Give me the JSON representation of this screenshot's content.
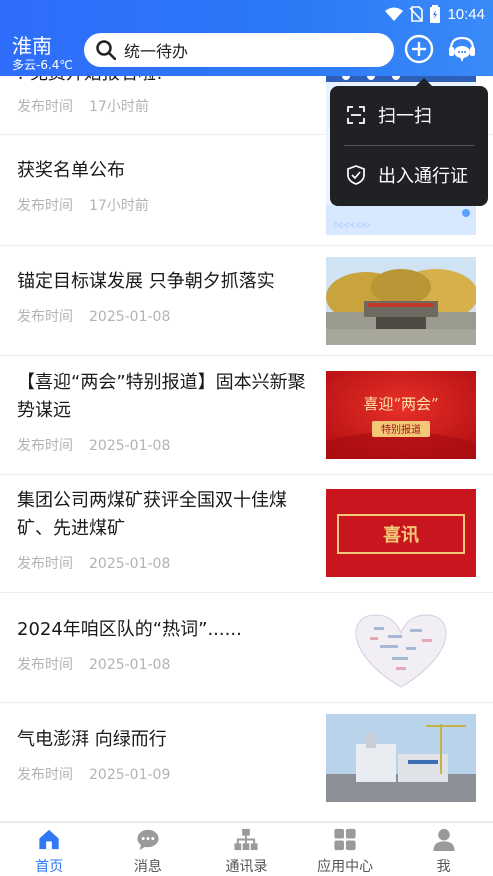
{
  "status": {
    "time": "10:44"
  },
  "header": {
    "city": "淮南",
    "weather": "多云-6.4℃",
    "search_placeholder": "统一待办"
  },
  "popup": {
    "scan_label": "扫一扫",
    "pass_label": "出入通行证"
  },
  "news": [
    {
      "title": "!·免费开始报名啦!",
      "meta_label": "发布时间",
      "time": "17小时前"
    },
    {
      "title": "获奖名单公布",
      "meta_label": "发布时间",
      "time": "17小时前"
    },
    {
      "title": "锚定目标谋发展 只争朝夕抓落实",
      "meta_label": "发布时间",
      "time": "2025-01-08"
    },
    {
      "title": "【喜迎“两会”特别报道】固本兴新聚势谋远",
      "meta_label": "发布时间",
      "time": "2025-01-08",
      "thumb_line1": "喜迎“两会”",
      "thumb_line2": "特别报道"
    },
    {
      "title": "集团公司两煤矿获评全国双十佳煤矿、先进煤矿",
      "meta_label": "发布时间",
      "time": "2025-01-08",
      "thumb_text": "喜讯"
    },
    {
      "title": "2024年咱区队的“热词”......",
      "meta_label": "发布时间",
      "time": "2025-01-08"
    },
    {
      "title": "气电澎湃 向绿而行",
      "meta_label": "发布时间",
      "time": "2025-01-09"
    }
  ],
  "tabs": [
    {
      "label": "首页",
      "icon": "home-icon",
      "active": true
    },
    {
      "label": "消息",
      "icon": "chat-icon",
      "active": false
    },
    {
      "label": "通讯录",
      "icon": "org-chart-icon",
      "active": false
    },
    {
      "label": "应用中心",
      "icon": "apps-grid-icon",
      "active": false
    },
    {
      "label": "我",
      "icon": "user-icon",
      "active": false
    }
  ],
  "colors": {
    "primary": "#2f78f6",
    "tab_inactive": "#9a9a9a",
    "popup_bg": "#1f2124"
  }
}
